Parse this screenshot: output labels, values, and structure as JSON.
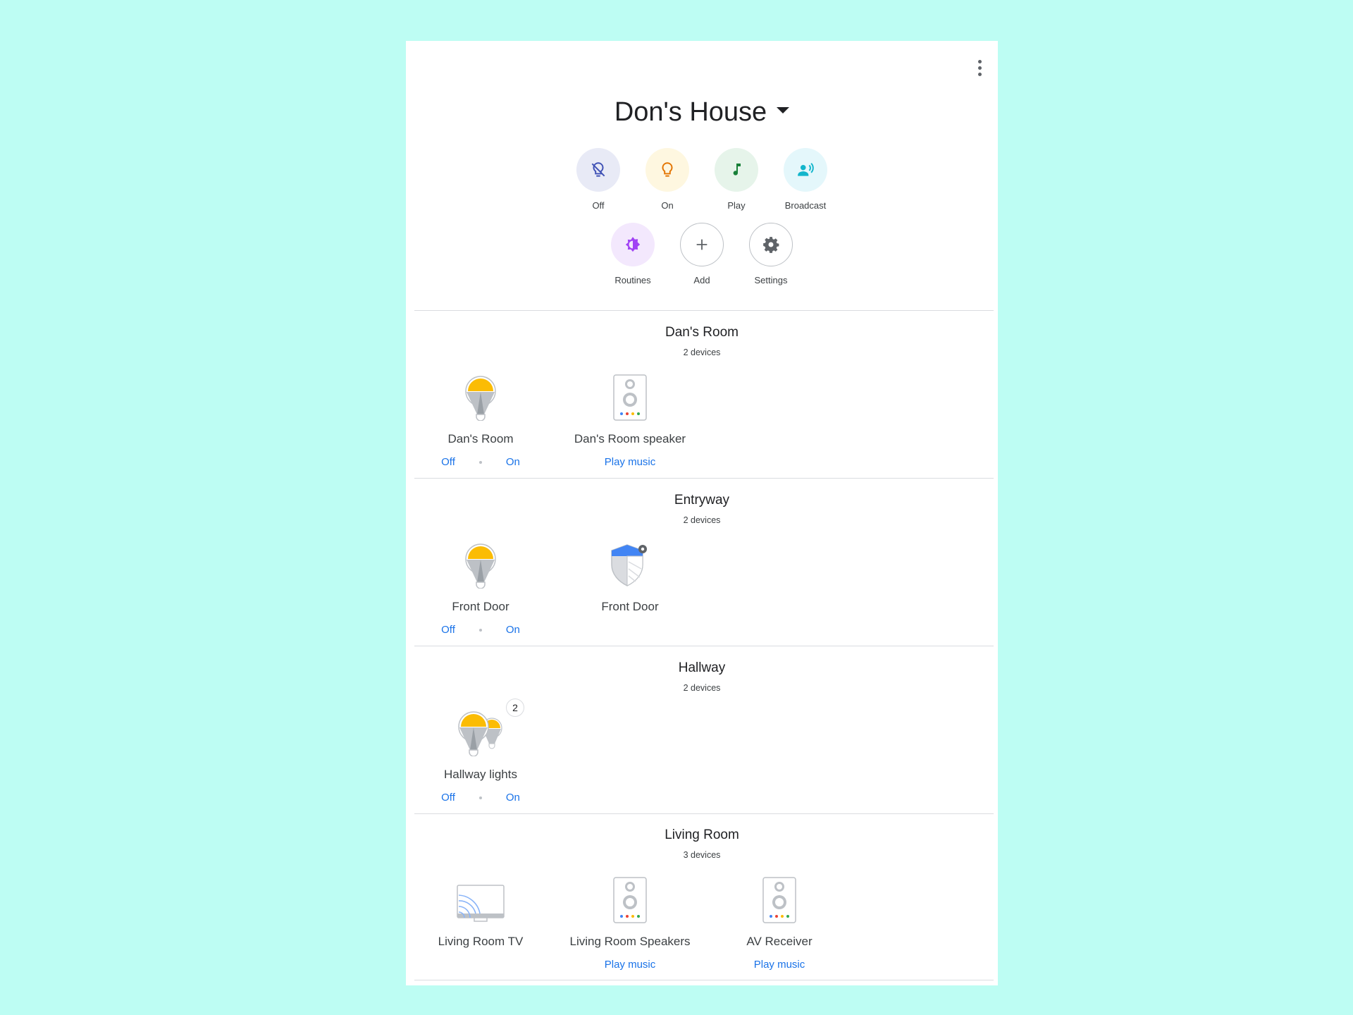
{
  "header": {
    "home_name": "Don's House"
  },
  "quick_actions": [
    {
      "label": "Off",
      "icon": "light-off-icon",
      "bg": "#e8eaf6",
      "fg": "#3f51b5"
    },
    {
      "label": "On",
      "icon": "light-on-icon",
      "bg": "#fef7e0",
      "fg": "#e37400"
    },
    {
      "label": "Play",
      "icon": "music-note-icon",
      "bg": "#e6f4ea",
      "fg": "#188038"
    },
    {
      "label": "Broadcast",
      "icon": "broadcast-icon",
      "bg": "#e4f7fb",
      "fg": "#12b5cb"
    },
    {
      "label": "Routines",
      "icon": "routines-icon",
      "bg": "#f3e8fd",
      "fg": "#a142f4"
    },
    {
      "label": "Add",
      "icon": "plus-icon"
    },
    {
      "label": "Settings",
      "icon": "gear-icon"
    }
  ],
  "rooms": [
    {
      "name": "Dan's Room",
      "count": "2 devices",
      "devices": [
        {
          "name": "Dan's Room",
          "icon": "light-bulb-icon",
          "off": "Off",
          "on": "On"
        },
        {
          "name": "Dan's Room speaker",
          "icon": "speaker-icon",
          "action": "Play music"
        }
      ]
    },
    {
      "name": "Entryway",
      "count": "2 devices",
      "devices": [
        {
          "name": "Front Door",
          "icon": "light-bulb-icon",
          "off": "Off",
          "on": "On"
        },
        {
          "name": "Front Door",
          "icon": "security-shield-icon"
        }
      ]
    },
    {
      "name": "Hallway",
      "count": "2 devices",
      "devices": [
        {
          "name": "Hallway lights",
          "icon": "light-group-icon",
          "badge": "2",
          "off": "Off",
          "on": "On"
        }
      ]
    },
    {
      "name": "Living Room",
      "count": "3 devices",
      "devices": [
        {
          "name": "Living Room TV",
          "icon": "cast-tv-icon"
        },
        {
          "name": "Living Room Speakers",
          "icon": "speaker-icon",
          "action": "Play music"
        },
        {
          "name": "AV Receiver",
          "icon": "speaker-icon",
          "action": "Play music"
        }
      ]
    }
  ],
  "colors": {
    "link": "#1a73e8",
    "bulb": "#fbbc04",
    "google_dots": [
      "#4285f4",
      "#ea4335",
      "#fbbc04",
      "#34a853"
    ]
  }
}
